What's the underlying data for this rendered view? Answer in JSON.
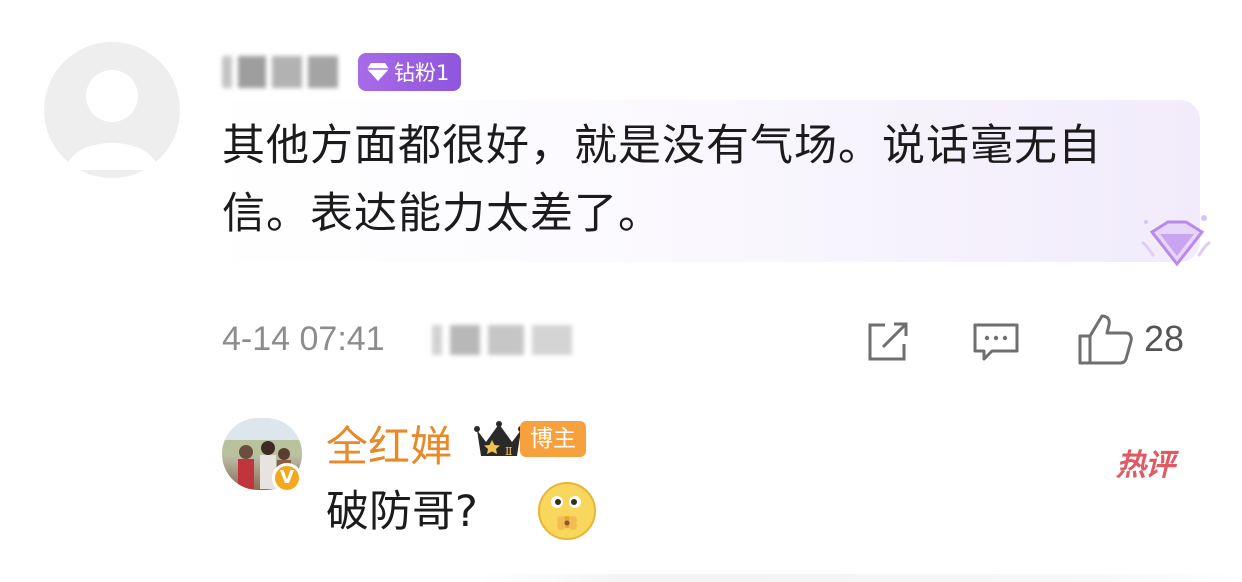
{
  "comment": {
    "username": "",
    "fan_badge": {
      "label": "钻粉1",
      "icon": "diamond-icon",
      "color": "#9b5fe0"
    },
    "text": "其他方面都很好，就是没有气场。说话毫无自信。表达能力太差了。",
    "timestamp": "4-14 07:41",
    "location": "",
    "actions": {
      "share_icon": "share-icon",
      "reply_icon": "comment-icon",
      "like_icon": "thumbs-up-icon",
      "like_count": "28"
    }
  },
  "reply": {
    "username": "全红婵",
    "username_color": "#e8892a",
    "level_icon": "crown-icon",
    "level_numeral": "Ⅱ",
    "role_badge": "博主",
    "hot_badge": "热评",
    "verified_mark": "V",
    "text": "破防哥?",
    "emoji_icon": "flower-emoji-icon"
  }
}
